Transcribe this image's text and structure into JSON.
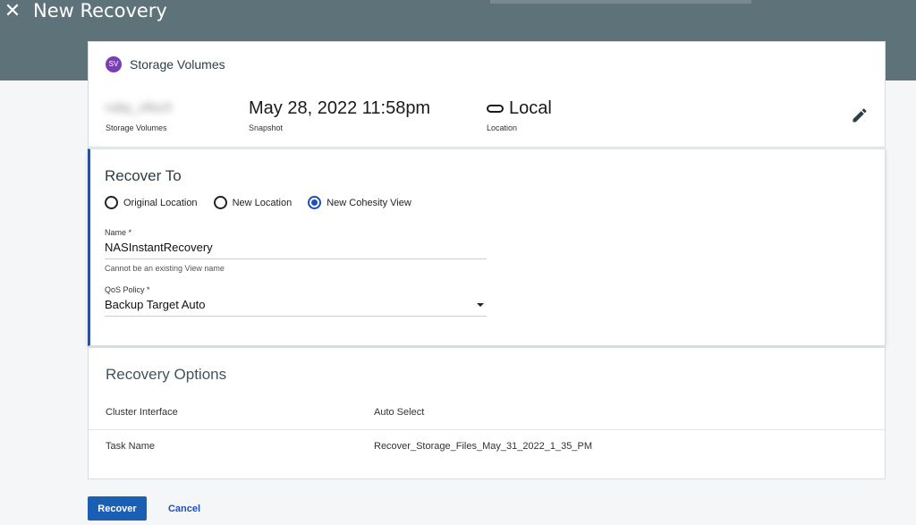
{
  "header": {
    "title": "New Recovery",
    "close_icon": "close-icon"
  },
  "summary": {
    "badge": "SV",
    "title": "Storage Volumes",
    "source_value": "ruby_nfsv3",
    "source_label": "Storage Volumes",
    "snapshot_value": "May 28, 2022 11:58pm",
    "snapshot_label": "Snapshot",
    "location_value": "Local",
    "location_label": "Location",
    "edit_icon": "pencil-icon"
  },
  "recover_to": {
    "title": "Recover To",
    "options": [
      {
        "label": "Original Location",
        "checked": false
      },
      {
        "label": "New Location",
        "checked": false
      },
      {
        "label": "New Cohesity View",
        "checked": true
      }
    ],
    "name_label": "Name *",
    "name_value": "NASInstantRecovery",
    "name_hint": "Cannot be an existing View name",
    "qos_label": "QoS Policy *",
    "qos_value": "Backup Target Auto"
  },
  "recovery_options": {
    "title": "Recovery Options",
    "rows": [
      {
        "key": "Cluster Interface",
        "value": "Auto Select"
      },
      {
        "key": "Task Name",
        "value": "Recover_Storage_Files_May_31_2022_1_35_PM"
      }
    ]
  },
  "actions": {
    "recover_label": "Recover",
    "cancel_label": "Cancel"
  },
  "colors": {
    "header_bg": "#5d7279",
    "accent": "#1a5fb4",
    "badge": "#7a3fb5"
  }
}
